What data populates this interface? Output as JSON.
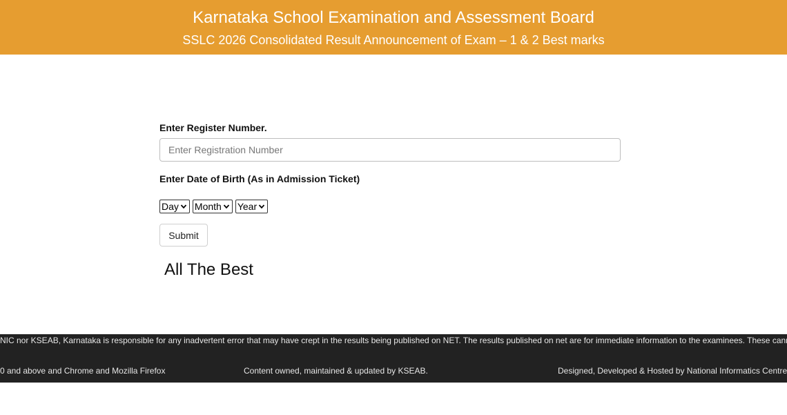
{
  "header": {
    "title": "Karnataka School Examination and Assessment Board",
    "subtitle": "SSLC 2026 Consolidated Result Announcement of Exam – 1 & 2 Best marks"
  },
  "form": {
    "register_label": "Enter Register Number.",
    "register_placeholder": "Enter Registration Number",
    "register_value": "",
    "dob_label": "Enter Date of Birth (As in Admission Ticket)",
    "day_select": "Day",
    "month_select": "Month",
    "year_select": "Year",
    "submit_label": "Submit",
    "message": "All The Best"
  },
  "footer": {
    "disclaimer": "NIC  nor KSEAB, Karnataka is responsible for any inadvertent error that may have crept in the results being published on NET. The results published on net are for immediate information to the examinees. These cannot be",
    "browser_note": "0 and above and Chrome and Mozilla Firefox",
    "content_note": "Content owned, maintained & updated by KSEAB.",
    "hosting_note": "Designed, Developed & Hosted by National Informatics Centre, K"
  },
  "colors": {
    "header_bg": "#e69d30",
    "footer_bg": "#222222"
  }
}
